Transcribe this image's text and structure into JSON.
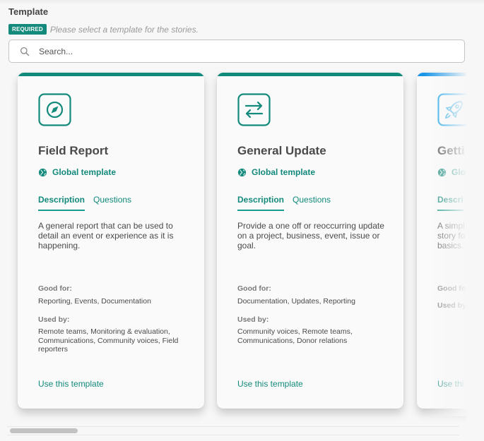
{
  "section": {
    "title": "Template",
    "required_badge": "REQUIRED",
    "required_hint": "Please select a template for the stories."
  },
  "search": {
    "placeholder": "Search...",
    "value": "",
    "icon": "search-icon"
  },
  "colors": {
    "accent": "#138a7c",
    "accent_blue": "#1a96e8",
    "text": "#4a4a4a",
    "muted": "#7a7a7a"
  },
  "templates": [
    {
      "title": "Field Report",
      "icon": "compass-icon",
      "scope": "Global template",
      "tabs": [
        "Description",
        "Questions"
      ],
      "active_tab": "Description",
      "description": "A general report that can be used to detail an event or experience as it is happening.",
      "good_for_label": "Good for:",
      "good_for": "Reporting, Events, Documentation",
      "used_by_label": "Used by:",
      "used_by": "Remote teams, Monitoring & evaluation, Communications, Community voices, Field reporters",
      "action": "Use this template"
    },
    {
      "title": "General Update",
      "icon": "swap-arrows-icon",
      "scope": "Global template",
      "tabs": [
        "Description",
        "Questions"
      ],
      "active_tab": "Description",
      "description": "Provide a one off or reoccurring update on a project, business, event, issue or goal.",
      "good_for_label": "Good for:",
      "good_for": "Documentation, Updates, Reporting",
      "used_by_label": "Used by:",
      "used_by": "Community voices, Remote teams, Communications, Donor relations",
      "action": "Use this template"
    },
    {
      "title": "Getti",
      "icon": "rocket-icon",
      "scope": "Glo",
      "tabs": [
        "Descri"
      ],
      "active_tab": "Descri",
      "description": "A simpl story fo basics.",
      "good_for_label": "Good fo",
      "used_by_label": "Used by",
      "action": "Use thi"
    }
  ]
}
